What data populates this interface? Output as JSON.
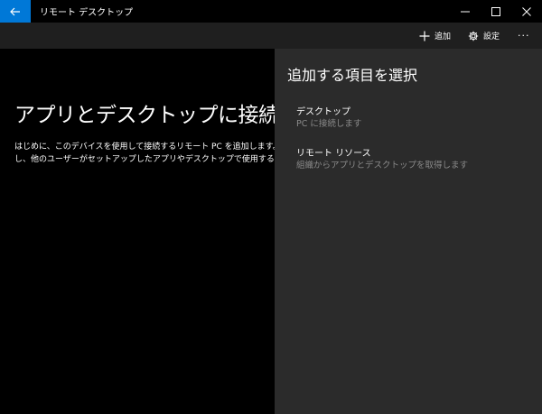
{
  "window": {
    "title": "リモート デスクトップ"
  },
  "commandbar": {
    "add_label": "追加",
    "settings_label": "設定",
    "more_label": "···"
  },
  "main": {
    "hero_title": "アプリとデスクトップに接続",
    "hero_description_lines": [
      "はじめに、このデバイスを使用して接続するリモート PC を追加します。リモ",
      "し、他のユーザーがセットアップしたアプリやデスクトップで使用することで"
    ]
  },
  "flyout": {
    "title": "追加する項目を選択",
    "options": [
      {
        "title": "デスクトップ",
        "subtitle": "PC に接続します"
      },
      {
        "title": "リモート リソース",
        "subtitle": "組織からアプリとデスクトップを取得します"
      }
    ]
  },
  "colors": {
    "accent": "#0078d7",
    "titlebar_bg": "#000000",
    "commandbar_bg": "#1f1f1f",
    "flyout_bg": "#2b2b2b",
    "secondary_text": "#8a8a8a"
  },
  "icons": {
    "back": "back-arrow-icon",
    "add": "plus-icon",
    "settings": "gear-icon",
    "more": "ellipsis-icon",
    "minimize": "minimize-icon",
    "maximize": "maximize-icon",
    "close": "close-icon"
  }
}
